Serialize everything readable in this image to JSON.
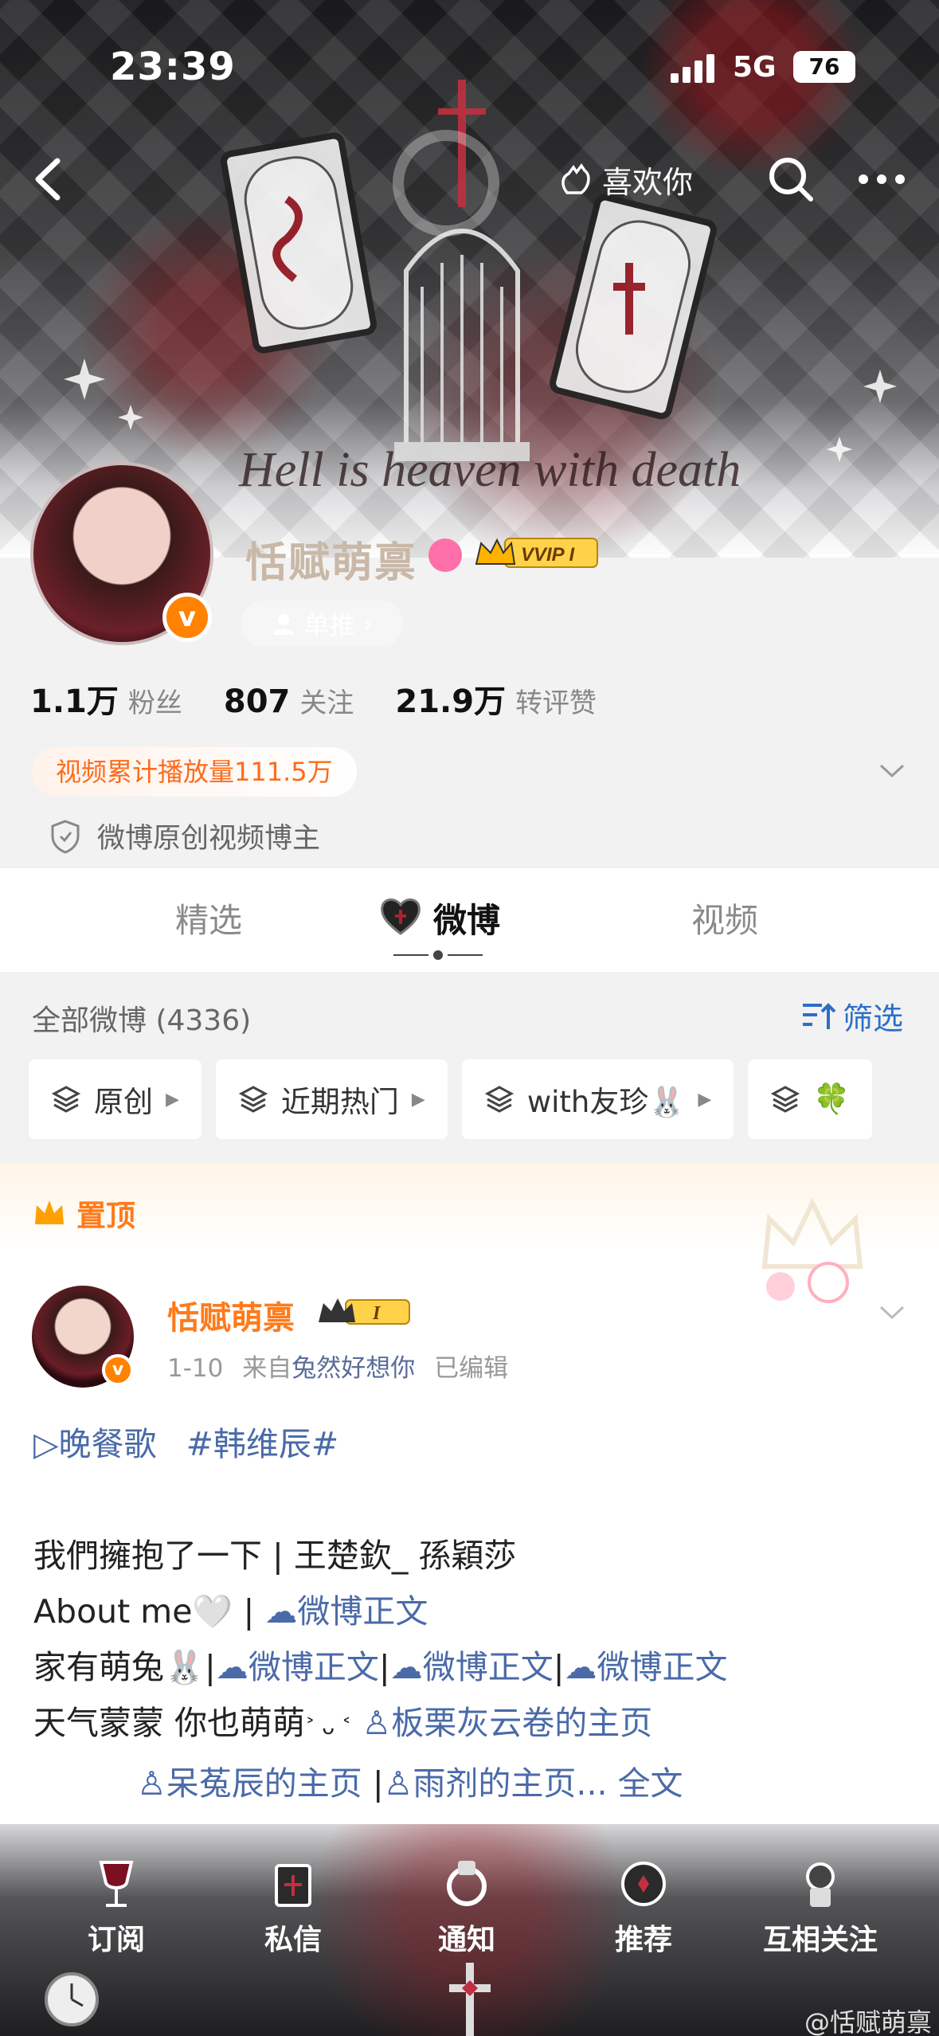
{
  "status_bar": {
    "time": "23:39",
    "network": "5G",
    "battery": "76"
  },
  "header": {
    "like_label": "喜欢你"
  },
  "banner": {
    "caption": "Hell is heaven with death"
  },
  "profile": {
    "name": "恬赋萌禀",
    "vip_label": "VVIP I",
    "tag": "单推",
    "tag_arrow": "›",
    "stats": [
      {
        "value": "1.1万",
        "label": "粉丝"
      },
      {
        "value": "807",
        "label": "关注"
      },
      {
        "value": "21.9万",
        "label": "转评赞"
      }
    ],
    "play_count": "视频累计播放量111.5万",
    "badge": "微博原创视频博主"
  },
  "tabs": [
    {
      "label": "精选"
    },
    {
      "label": "微博"
    },
    {
      "label": "视频"
    }
  ],
  "filter": {
    "all_posts": "全部微博 (4336)",
    "filter_label": "筛选",
    "chips": [
      {
        "label": "原创"
      },
      {
        "label": "近期热门"
      },
      {
        "label": "with友珍🐰"
      },
      {
        "label": "🍀"
      }
    ]
  },
  "post": {
    "pinned": "置顶",
    "author": "恬赋萌禀",
    "level": "I",
    "date": "1-10",
    "from": "来自",
    "source": "兔然好想你",
    "edited": "已编辑",
    "song_link": "▷晚餐歌",
    "hashtag": "#韩维辰#",
    "line1": "我們擁抱了一下 | 王楚欽_ 孫穎莎",
    "line2_text": "About me🤍 | ",
    "weibo_link": "微博正文",
    "line3_text": "家有萌兔🐰|",
    "sep": "|",
    "line4_text": "天气蒙蒙 你也萌萌",
    "kaomoji": "˃ ᴗ ˂",
    "link_a": "板栗灰云卷的主页",
    "link_b": "呆菟辰的主页",
    "link_c": "雨剂的主页...",
    "full_text": "全文"
  },
  "bottom_nav": [
    {
      "label": "订阅"
    },
    {
      "label": "私信"
    },
    {
      "label": "通知"
    },
    {
      "label": "推荐"
    },
    {
      "label": "互相关注"
    }
  ],
  "watermark": "@恬赋萌禀",
  "colors": {
    "orange": "#ff7a1a",
    "link": "#4a6aa8",
    "accent_blue": "#2c6fca"
  }
}
